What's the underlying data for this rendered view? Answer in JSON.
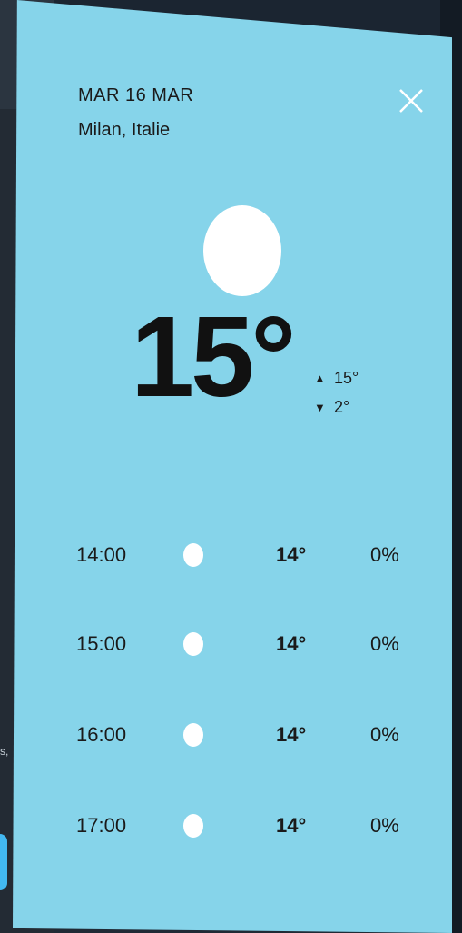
{
  "background": {
    "side_text": "s,"
  },
  "weather": {
    "date": "MAR 16 MAR",
    "location": "Milan, Italie",
    "current_temp": "15°",
    "high": "15°",
    "low": "2°",
    "condition_icon": "sun-icon",
    "hourly": [
      {
        "time": "14:00",
        "temp": "14°",
        "precip": "0%"
      },
      {
        "time": "15:00",
        "temp": "14°",
        "precip": "0%"
      },
      {
        "time": "16:00",
        "temp": "14°",
        "precip": "0%"
      },
      {
        "time": "17:00",
        "temp": "14°",
        "precip": "0%"
      }
    ]
  },
  "colors": {
    "panel_bg": "#86d4ea",
    "text": "#111111",
    "icon": "#ffffff"
  }
}
